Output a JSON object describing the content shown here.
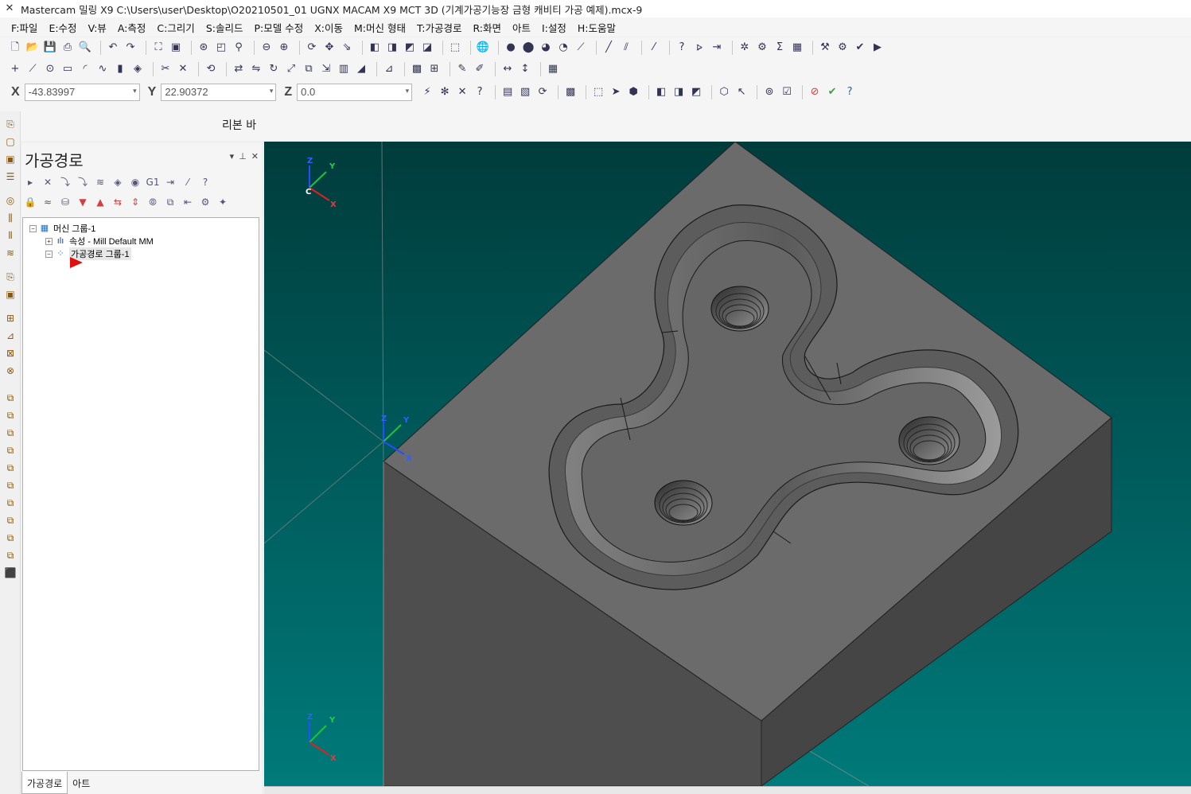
{
  "window": {
    "title": "Mastercam 밀링 X9  C:\\Users\\user\\Desktop\\O20210501_01 UGNX MACAM X9 MCT 3D (기계가공기능장 금형 캐비티 가공 예제).mcx-9"
  },
  "menu": [
    "F:파일",
    "E:수정",
    "V:뷰",
    "A:측정",
    "C:그리기",
    "S:솔리드",
    "P:모델 수정",
    "X:이동",
    "M:머신 형태",
    "T:가공경로",
    "R:화면",
    "아트",
    "I:설정",
    "H:도움말"
  ],
  "coords": {
    "x_label": "X",
    "x_value": "-43.83997",
    "y_label": "Y",
    "y_value": "22.90372",
    "z_label": "Z",
    "z_value": "0.0"
  },
  "ribbon": {
    "label": "리본 바"
  },
  "panel": {
    "title": "가공경로",
    "tree": {
      "machine_group": "머신 그룹-1",
      "properties": "속성 - Mill Default MM",
      "toolpath_group": "가공경로 그룹-1"
    },
    "tabs": [
      "가공경로",
      "아트"
    ]
  },
  "viewport": {
    "background_top": "#003c3c",
    "background_bottom": "#007a7a",
    "part_top_color": "#6b6b6b",
    "part_side_color": "#454545",
    "axis_labels": {
      "x": "X",
      "y": "Y",
      "z": "Z",
      "c": "C"
    }
  },
  "icons": {
    "toolbar1": [
      "new-file-icon",
      "open-icon",
      "save-icon",
      "print-icon",
      "print-preview-icon",
      "undo-icon",
      "redo-icon",
      "fit-icon",
      "zoom-window-icon",
      "zoom-target-icon",
      "zoom-selected-icon",
      "zoom-out-icon",
      "zoom-in-icon",
      "rotate-icon",
      "pan-icon",
      "dynamic-icon",
      "view-top-icon",
      "view-front-icon",
      "view-right-icon",
      "view-iso-icon",
      "plane-icon",
      "wireframe-icon",
      "shaded-icon",
      "solid-icon",
      "hidden-icon",
      "translucent-icon",
      "line-style-icon",
      "analyze-icon",
      "help-cursor-icon",
      "run-addin-icon",
      "settings-icon",
      "sum-icon",
      "grid-icon",
      "cad-tool-icon",
      "cam-tool-icon",
      "verify-icon",
      "simulate-icon"
    ],
    "toolbar2": [
      "point-icon",
      "line-icon",
      "circle-icon",
      "rectangle-icon",
      "arc-icon",
      "spline-icon",
      "solid-extrude-icon",
      "surface-icon",
      "trim-icon",
      "delete-icon",
      "regen-icon",
      "transform-icon",
      "mirror-icon",
      "rotate-xform-icon",
      "scale-icon",
      "offset-icon",
      "project-icon",
      "array-icon",
      "drafting-icon",
      "dimension-icon",
      "note-icon",
      "measure-icon",
      "grid-snap-icon"
    ]
  }
}
